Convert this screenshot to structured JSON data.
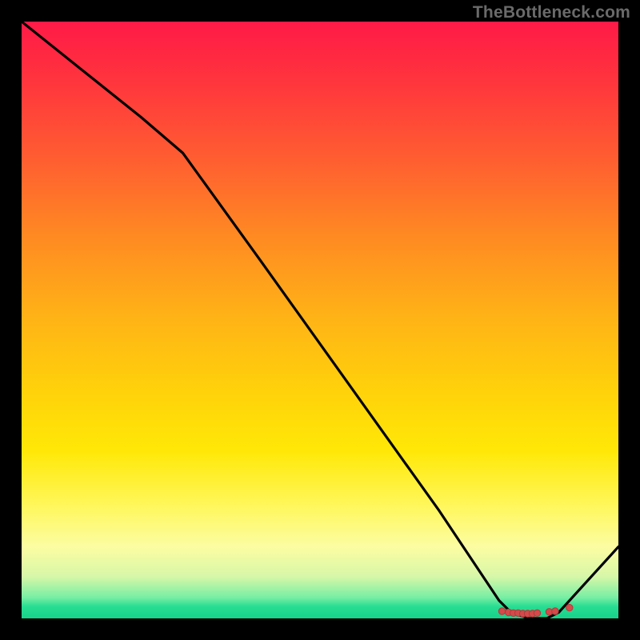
{
  "watermark": "TheBottleneck.com",
  "chart_data": {
    "type": "line",
    "title": "",
    "xlabel": "",
    "ylabel": "",
    "xlim": [
      0,
      100
    ],
    "ylim": [
      0,
      100
    ],
    "grid": false,
    "legend": false,
    "series": [
      {
        "name": "curve",
        "x": [
          0,
          10,
          20,
          27,
          40,
          55,
          70,
          80,
          82,
          85,
          88,
          90,
          100
        ],
        "y": [
          100,
          92,
          84,
          78,
          60,
          39,
          18,
          3,
          1,
          0,
          0,
          1,
          12
        ]
      }
    ],
    "markers": {
      "name": "bottom-cluster",
      "x": [
        80.5,
        81.6,
        82.4,
        83.2,
        84.0,
        84.8,
        85.6,
        86.4,
        88.4,
        89.4,
        91.8
      ],
      "y": [
        1.2,
        1.0,
        0.9,
        0.9,
        0.8,
        0.8,
        0.8,
        0.9,
        1.1,
        1.2,
        1.8
      ]
    }
  }
}
